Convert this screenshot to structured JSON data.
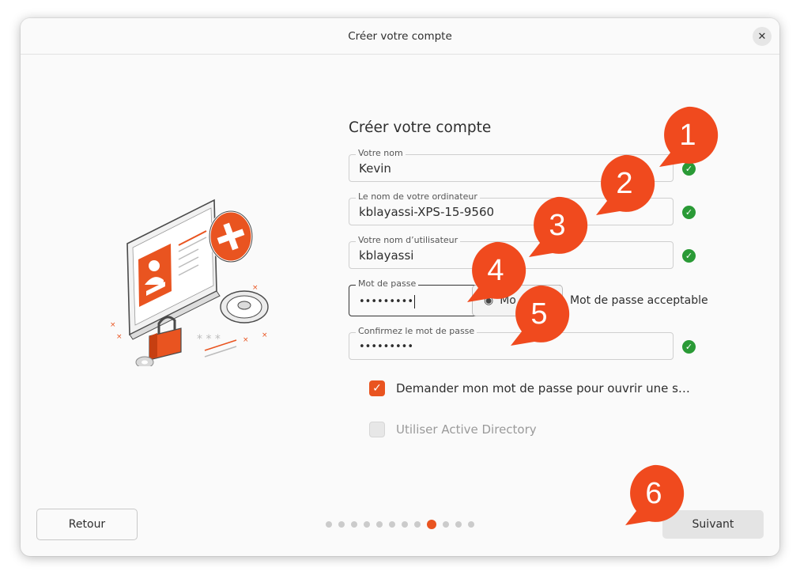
{
  "window": {
    "title": "Créer votre compte"
  },
  "form": {
    "heading": "Créer votre compte",
    "name": {
      "label": "Votre nom",
      "value": "Kevin"
    },
    "computer": {
      "label": "Le nom de votre ordinateur",
      "value": "kblayassi-XPS-15-9560"
    },
    "username": {
      "label": "Votre nom d’utilisateur",
      "value": "kblayassi"
    },
    "password": {
      "label": "Mot de passe",
      "value": "•••••••••",
      "show_label": "Mo",
      "strength": "Mot de passe acceptable"
    },
    "confirm": {
      "label": "Confirmez le mot de passe",
      "value": "•••••••••"
    },
    "require_password": {
      "label": "Demander mon mot de passe pour ouvrir une s…",
      "checked": true
    },
    "active_directory": {
      "label": "Utiliser Active Directory",
      "checked": false,
      "enabled": false
    }
  },
  "footer": {
    "back_label": "Retour",
    "next_label": "Suivant",
    "steps_total": 12,
    "steps_active": 9
  },
  "callouts": [
    "1",
    "2",
    "3",
    "4",
    "5",
    "6"
  ],
  "colors": {
    "accent": "#e95420",
    "success": "#2a9a36",
    "callout": "#f04a1e"
  },
  "icons": {
    "close": "close-icon",
    "check": "check-icon",
    "eye": "eye-icon"
  }
}
